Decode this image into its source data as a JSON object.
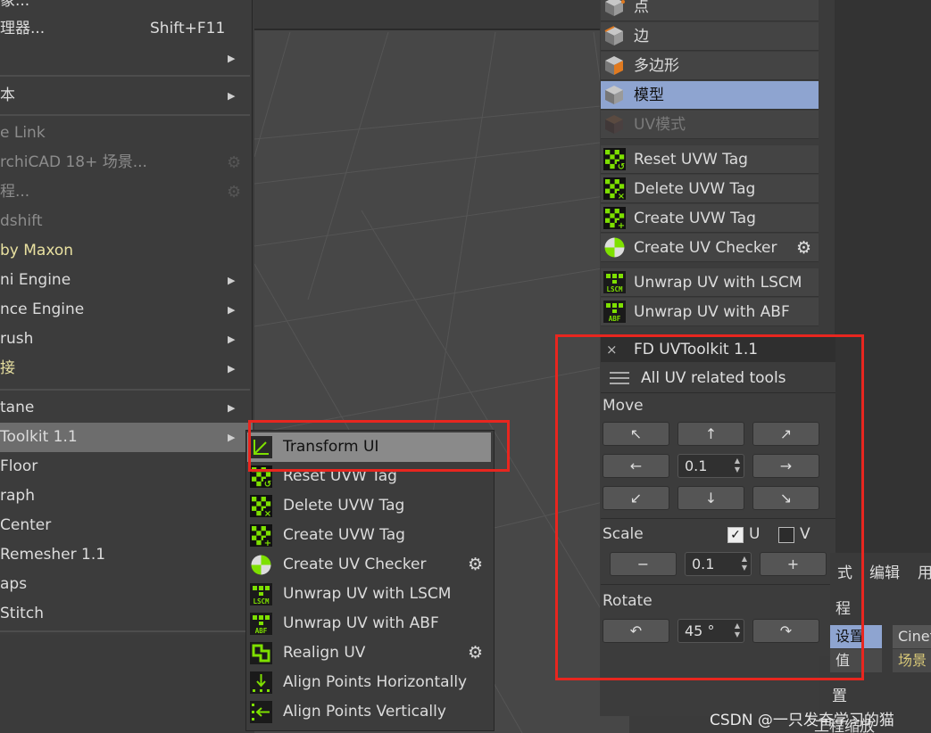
{
  "left_menu": {
    "items": [
      {
        "label": "象...",
        "shortcut": "",
        "arrow": false,
        "state": "normal"
      },
      {
        "label": "理器...",
        "shortcut": "Shift+F11",
        "arrow": false,
        "state": "normal"
      },
      {
        "label": "",
        "shortcut": "",
        "arrow": true,
        "state": "normal"
      },
      {
        "label": "本",
        "shortcut": "",
        "arrow": true,
        "state": "normal"
      },
      {
        "label": "e Link",
        "shortcut": "",
        "arrow": false,
        "state": "disabled"
      },
      {
        "label": "rchiCAD 18+ 场景...",
        "shortcut": "",
        "arrow": false,
        "state": "disabled",
        "gear": true
      },
      {
        "label": "程...",
        "shortcut": "",
        "arrow": false,
        "state": "disabled",
        "gear": true
      },
      {
        "label": "dshift",
        "shortcut": "",
        "arrow": false,
        "state": "disabled"
      },
      {
        "label": " by Maxon",
        "shortcut": "",
        "arrow": false,
        "state": "highlight-yellow"
      },
      {
        "label": "ni Engine",
        "shortcut": "",
        "arrow": true,
        "state": "normal"
      },
      {
        "label": "nce Engine",
        "shortcut": "",
        "arrow": true,
        "state": "normal"
      },
      {
        "label": "rush",
        "shortcut": "",
        "arrow": true,
        "state": "normal"
      },
      {
        "label": "接",
        "shortcut": "",
        "arrow": true,
        "state": "yellow"
      },
      {
        "label": "tane",
        "shortcut": "",
        "arrow": true,
        "state": "normal"
      },
      {
        "label": "Toolkit 1.1",
        "shortcut": "",
        "arrow": true,
        "state": "hover"
      },
      {
        "label": "Floor",
        "shortcut": "",
        "arrow": false,
        "state": "normal"
      },
      {
        "label": "raph",
        "shortcut": "",
        "arrow": false,
        "state": "normal"
      },
      {
        "label": "Center",
        "shortcut": "",
        "arrow": false,
        "state": "normal"
      },
      {
        "label": "Remesher 1.1",
        "shortcut": "",
        "arrow": false,
        "state": "normal"
      },
      {
        "label": "aps",
        "shortcut": "",
        "arrow": false,
        "state": "normal"
      },
      {
        "label": "Stitch",
        "shortcut": "",
        "arrow": false,
        "state": "normal"
      }
    ]
  },
  "submenu": {
    "items": [
      {
        "label": "Transform UI",
        "icon": "transform-icon",
        "gear": false
      },
      {
        "label": "Reset UVW Tag",
        "icon": "reset-uvw-tag-icon",
        "gear": false
      },
      {
        "label": "Delete UVW Tag",
        "icon": "delete-uvw-tag-icon",
        "gear": false
      },
      {
        "label": "Create UVW Tag",
        "icon": "create-uvw-tag-icon",
        "gear": false
      },
      {
        "label": "Create UV Checker",
        "icon": "uv-checker-icon",
        "gear": true
      },
      {
        "label": "Unwrap UV with LSCM",
        "icon": "lscm-icon",
        "gear": false
      },
      {
        "label": "Unwrap UV with ABF",
        "icon": "abf-icon",
        "gear": false
      },
      {
        "label": "Realign UV",
        "icon": "realign-uv-icon",
        "gear": true
      },
      {
        "label": "Align Points Horizontally",
        "icon": "align-horizontal-icon",
        "gear": false
      },
      {
        "label": "Align Points Vertically",
        "icon": "align-vertical-icon",
        "gear": false
      }
    ]
  },
  "right_panel": {
    "modes": [
      {
        "label": "点",
        "icon": "point-mode-icon",
        "state": "normal"
      },
      {
        "label": "边",
        "icon": "edge-mode-icon",
        "state": "normal"
      },
      {
        "label": "多边形",
        "icon": "polygon-mode-icon",
        "state": "normal"
      },
      {
        "label": "模型",
        "icon": "model-mode-icon",
        "state": "selected"
      },
      {
        "label": "UV模式",
        "icon": "uv-mode-icon",
        "state": "disabled"
      }
    ],
    "tools": [
      {
        "label": "Reset UVW Tag",
        "icon": "reset-uvw-tag-icon",
        "gear": false
      },
      {
        "label": "Delete UVW Tag",
        "icon": "delete-uvw-tag-icon",
        "gear": false
      },
      {
        "label": "Create UVW Tag",
        "icon": "create-uvw-tag-icon",
        "gear": false
      },
      {
        "label": "Create UV Checker",
        "icon": "uv-checker-icon",
        "gear": true
      },
      {
        "label": "Unwrap UV with LSCM",
        "icon": "lscm-icon",
        "gear": false
      },
      {
        "label": "Unwrap UV with ABF",
        "icon": "abf-icon",
        "gear": false
      }
    ]
  },
  "uv_panel": {
    "title": "FD UVToolkit 1.1",
    "close": "×",
    "header": "All UV related tools",
    "move": {
      "label": "Move",
      "arrows": [
        "↖",
        "↑",
        "↗",
        "←",
        "→",
        "↙",
        "↓",
        "↘"
      ],
      "value": "0.1"
    },
    "scale": {
      "label": "Scale",
      "u_label": "U",
      "u_checked": true,
      "v_label": "V",
      "v_checked": false,
      "minus": "−",
      "plus": "+",
      "value": "0.1"
    },
    "rotate": {
      "label": "Rotate",
      "ccw": "↶",
      "cw": "↷",
      "value": "45 °"
    }
  },
  "bottom_right": {
    "menu": [
      "式",
      "编辑",
      "用"
    ],
    "row1": "程",
    "cells": [
      "设置",
      "Cinet",
      "值",
      "场景"
    ],
    "row4": "置",
    "row5": "工程缩放"
  },
  "watermark": "CSDN @一只发奋学习的猫",
  "colors": {
    "highlight_red": "#e8261f",
    "selected_mode": "#8ea4d0",
    "icon_green": "#7ee000"
  }
}
